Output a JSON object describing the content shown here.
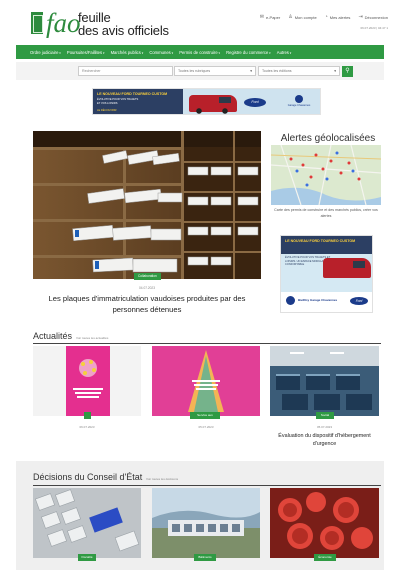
{
  "header": {
    "logo_line1": "feuille",
    "logo_line2": "des avis officiels",
    "links": [
      {
        "icon": "mail-icon",
        "glyph": "✉",
        "label": "e-Paper"
      },
      {
        "icon": "user-icon",
        "glyph": "♙",
        "label": "Mon compte"
      },
      {
        "icon": "bell-icon",
        "glyph": "◔",
        "label": "Mes alertes"
      },
      {
        "icon": "logout-icon",
        "glyph": "⇥",
        "label": "Déconnexion"
      }
    ],
    "date": "06.07.2023 | 04:47 1"
  },
  "nav": {
    "items": [
      "Ordre judiciaire",
      "Poursuites/Faillites",
      "Marchés publics",
      "Communes",
      "Permis de construire",
      "Registre du commerce",
      "Autres"
    ]
  },
  "search": {
    "placeholder": "Rechercher",
    "rubriques": "Toutes les rubriques",
    "editions": "Toutes les éditions",
    "button_glyph": "⚲"
  },
  "ad_banner": {
    "title": "LE NOUVEAU FORD TOURNEO CUSTOM",
    "line1": "ÉVOLUTIVE POUR VOS TRAJETS",
    "line2": "ET VOS LOISIRS",
    "cta": "LE DÉCOUVRIR",
    "brand": "Ford",
    "dealer": "Garage Chavannes"
  },
  "hero": {
    "tag": "Collaboration",
    "date": "04.07.2023",
    "title": "Les plaques d'immatriculation vaudoises produites par des personnes détenues"
  },
  "alerts": {
    "title": "Alertes géolocalisées",
    "caption": "Carte des permis de construire et des marchés publics, créer vos alertes"
  },
  "side_ad": {
    "title": "LE NOUVEAU FORD TOURNEO CUSTOM",
    "copy": "ÉVOLUTIVE POUR VOS TRAJETS ET LOISIRS. UN ESPACE MODULABLE ET CONFORTABLE",
    "cta": "LE DÉCOUVRIR",
    "dealer": "BielRoy Garage Chavannes",
    "brand": "Ford"
  },
  "actualites": {
    "title": "Actualités",
    "more": "Voir toutes les actualités",
    "cards": [
      {
        "tag": "",
        "date": "06.07.2023",
        "title": ""
      },
      {
        "tag": "Service aux",
        "date": "05.07.2023",
        "title": ""
      },
      {
        "tag": "Social",
        "date": "05.07.2023",
        "title": "Évaluation du dispositif d'hébergement d'urgence"
      }
    ]
  },
  "decisions": {
    "title": "Décisions du Conseil d'État",
    "more": "Voir toutes les décisions",
    "cards": [
      {
        "tag": "Fiscalité"
      },
      {
        "tag": "Bâtiments"
      },
      {
        "tag": "Économie"
      }
    ]
  },
  "colors": {
    "brand_green": "#2f9a43",
    "nav_text": "#ffffff",
    "ford_blue": "#1b3b8a"
  }
}
